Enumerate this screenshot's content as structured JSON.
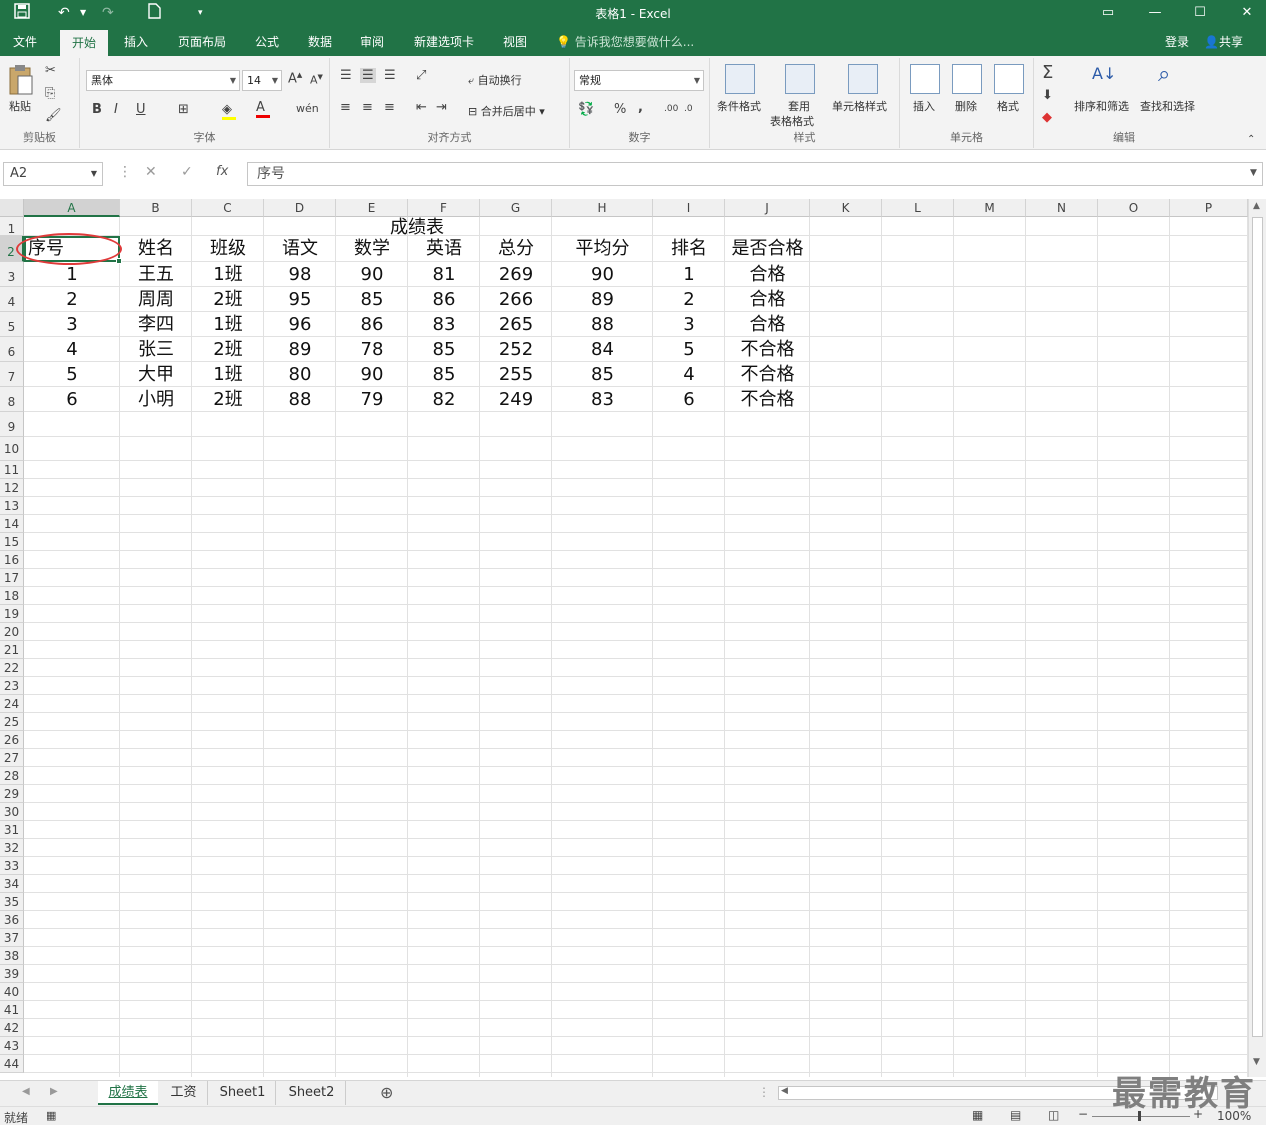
{
  "window": {
    "title": "表格1 - Excel"
  },
  "quick_access": {
    "save": "💾",
    "undo": "↶",
    "redo": "↷",
    "new": "🗋"
  },
  "menu": {
    "tabs": [
      "文件",
      "开始",
      "插入",
      "页面布局",
      "公式",
      "数据",
      "审阅",
      "新建选项卡",
      "视图"
    ],
    "active": "开始",
    "tell_me": "告诉我您想要做什么...",
    "login": "登录",
    "share": "共享"
  },
  "ribbon": {
    "clipboard": {
      "paste": "粘贴",
      "label": "剪贴板"
    },
    "font": {
      "name": "黑体",
      "size": "14",
      "label": "字体",
      "bold": "B",
      "italic": "I",
      "underline": "U"
    },
    "align": {
      "wrap": "自动换行",
      "merge": "合并后居中",
      "label": "对齐方式"
    },
    "number": {
      "format": "常规",
      "percent": "%",
      "comma": ",",
      "label": "数字"
    },
    "styles": {
      "conditional": "条件格式",
      "table_fmt_1": "套用",
      "table_fmt_2": "表格格式",
      "cell_style": "单元格样式",
      "label": "样式"
    },
    "cells": {
      "insert": "插入",
      "delete": "删除",
      "format": "格式",
      "label": "单元格"
    },
    "editing": {
      "sort": "排序和筛选",
      "find": "查找和选择",
      "label": "编辑"
    }
  },
  "formula_bar": {
    "name_box": "A2",
    "fx": "fx",
    "content": "序号"
  },
  "columns": [
    "A",
    "B",
    "C",
    "D",
    "E",
    "F",
    "G",
    "H",
    "I",
    "J",
    "K",
    "L",
    "M",
    "N",
    "O",
    "P"
  ],
  "table": {
    "title": "成绩表",
    "headers": [
      "序号",
      "姓名",
      "班级",
      "语文",
      "数学",
      "英语",
      "总分",
      "平均分",
      "排名",
      "是否合格"
    ],
    "rows": [
      [
        "1",
        "王五",
        "1班",
        "98",
        "90",
        "81",
        "269",
        "90",
        "1",
        "合格"
      ],
      [
        "2",
        "周周",
        "2班",
        "95",
        "85",
        "86",
        "266",
        "89",
        "2",
        "合格"
      ],
      [
        "3",
        "李四",
        "1班",
        "96",
        "86",
        "83",
        "265",
        "88",
        "3",
        "合格"
      ],
      [
        "4",
        "张三",
        "2班",
        "89",
        "78",
        "85",
        "252",
        "84",
        "5",
        "不合格"
      ],
      [
        "5",
        "大甲",
        "1班",
        "80",
        "90",
        "85",
        "255",
        "85",
        "4",
        "不合格"
      ],
      [
        "6",
        "小明",
        "2班",
        "88",
        "79",
        "82",
        "249",
        "83",
        "6",
        "不合格"
      ]
    ]
  },
  "sheet_tabs": [
    "成绩表",
    "工资",
    "Sheet1",
    "Sheet2"
  ],
  "active_sheet": "成绩表",
  "status": {
    "ready": "就绪",
    "zoom": "100%"
  },
  "watermark": "最需教育",
  "colors": {
    "accent": "#217346",
    "annotation": "#e03a3a"
  }
}
